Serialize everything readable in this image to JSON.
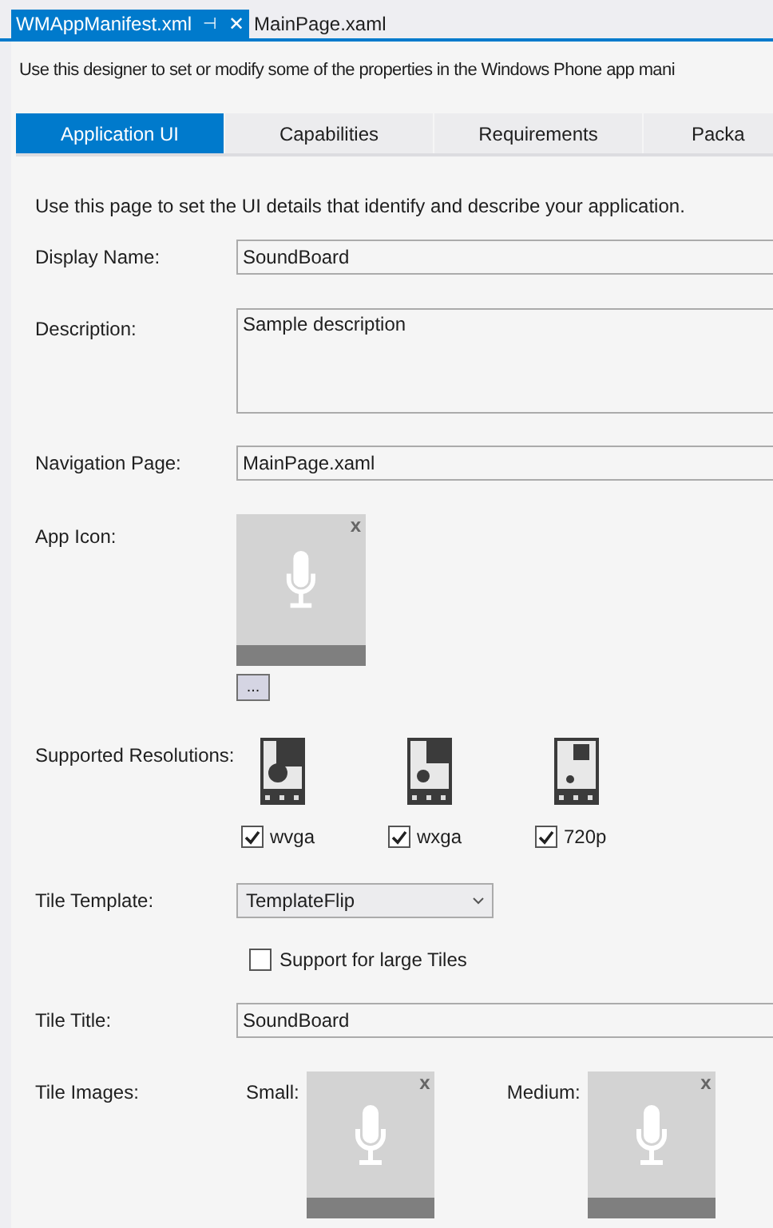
{
  "document_tabs": [
    {
      "label": "WMAppManifest.xml",
      "selected": true,
      "pin": "⊣",
      "close": "✕"
    },
    {
      "label": "MainPage.xaml",
      "selected": false
    }
  ],
  "intro": "Use this designer to set or modify some of the properties in the Windows Phone app mani",
  "tabs": [
    {
      "label": "Application UI",
      "selected": true
    },
    {
      "label": "Capabilities",
      "selected": false
    },
    {
      "label": "Requirements",
      "selected": false
    },
    {
      "label": "Packa",
      "selected": false
    }
  ],
  "page_description": "Use this page to set the UI details that identify and describe your application.",
  "display_name": {
    "label": "Display Name:",
    "value": "SoundBoard"
  },
  "description": {
    "label": "Description:",
    "value": "Sample description"
  },
  "navigation_page": {
    "label": "Navigation Page:",
    "value": "MainPage.xaml"
  },
  "app_icon": {
    "label": "App Icon:",
    "remove": "x",
    "browse": "..."
  },
  "resolutions": {
    "label": "Supported Resolutions:",
    "items": [
      {
        "label": "wvga",
        "checked": true
      },
      {
        "label": "wxga",
        "checked": true
      },
      {
        "label": "720p",
        "checked": true
      }
    ]
  },
  "tile_template": {
    "label": "Tile Template:",
    "value": "TemplateFlip"
  },
  "large_tiles": {
    "label": "Support for large Tiles",
    "checked": false
  },
  "tile_title": {
    "label": "Tile Title:",
    "value": "SoundBoard"
  },
  "tile_images": {
    "label": "Tile Images:",
    "items": [
      {
        "label": "Small:",
        "remove": "x"
      },
      {
        "label": "Medium:",
        "remove": "x"
      }
    ]
  }
}
